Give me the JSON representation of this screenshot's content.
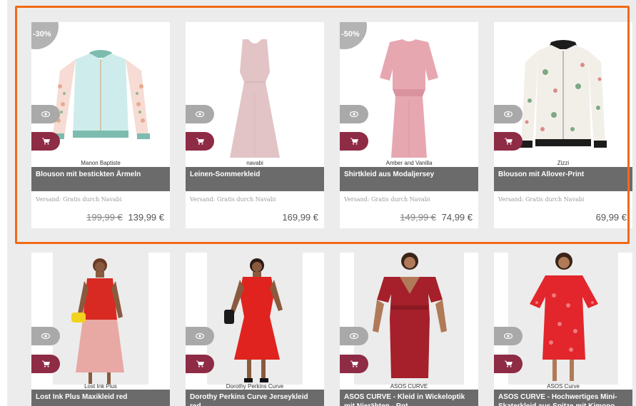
{
  "products_row1": [
    {
      "discount": "-30%",
      "brand": "Manon Baptiste",
      "title": "Blouson mit bestickten Ärmeln",
      "shipping": "Versand: Gratis  durch Navabi",
      "old_price": "199,99 €",
      "price": "139,99 €"
    },
    {
      "discount": "",
      "brand": "navabi",
      "title": "Leinen-Sommerkleid",
      "shipping": "Versand: Gratis  durch Navabi",
      "old_price": "",
      "price": "169,99 €"
    },
    {
      "discount": "-50%",
      "brand": "Amber and Vanilla",
      "title": "Shirtkleid aus Modaljersey",
      "shipping": "Versand: Gratis  durch Navabi",
      "old_price": "149,99 €",
      "price": "74,99 €"
    },
    {
      "discount": "",
      "brand": "Zizzi",
      "title": "Blouson mit Allover-Print",
      "shipping": "Versand: Gratis  durch Navabi",
      "old_price": "",
      "price": "69,99 €"
    }
  ],
  "products_row2": [
    {
      "brand": "Lost Ink Plus",
      "title": "Lost Ink Plus Maxikleid red"
    },
    {
      "brand": "Dorothy Perkins Curve",
      "title": "Dorothy Perkins Curve Jerseykleid red"
    },
    {
      "brand": "ASOS CURVE",
      "title": "ASOS CURVE - Kleid in Wickeloptik mit Nierähten - Rot"
    },
    {
      "brand": "ASOS Curve",
      "title": "ASOS CURVE - Hochwertiges Mini-Skaterkleid aus Spitze mit Kimono"
    }
  ],
  "icons": {
    "quick_view": "eye-icon",
    "add_to_cart": "cart-icon"
  },
  "colors": {
    "highlight": "#f26a16",
    "cart_button": "#8e2b45",
    "view_button": "#a9a9a9",
    "title_bar": "#6b6b6b",
    "badge": "#b3b3b3"
  }
}
